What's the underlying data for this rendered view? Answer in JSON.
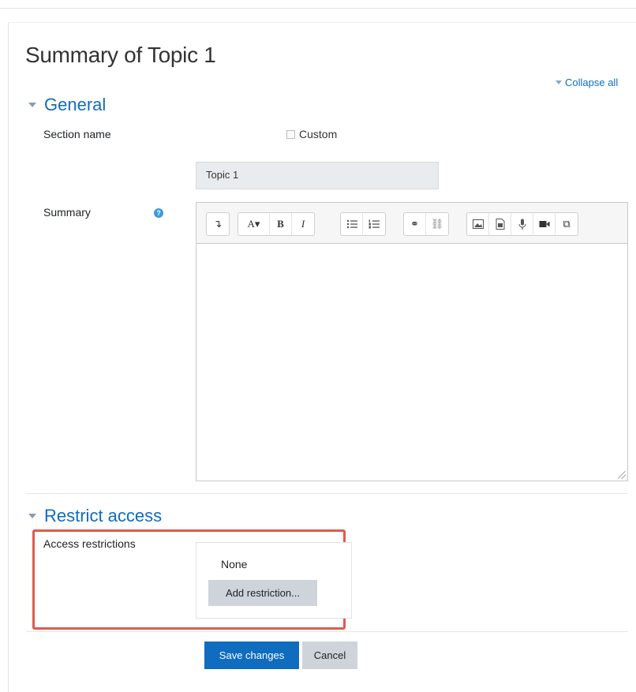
{
  "page": {
    "title": "Summary of Topic 1",
    "collapse_all": "Collapse all"
  },
  "general": {
    "legend": "General",
    "section_name_label": "Section name",
    "custom_label": "Custom",
    "section_name_value": "Topic 1",
    "summary_label": "Summary",
    "help_glyph": "?"
  },
  "editor": {
    "toolbar": {
      "paragraph": "↴",
      "font": "A▾",
      "bold": "B",
      "italic": "I",
      "link": "⚭",
      "unlink": "⛓",
      "image": "▭",
      "media": "▤",
      "record_audio": "🎙",
      "record_video": "■",
      "manage_files": "⧉"
    },
    "content": ""
  },
  "restrict": {
    "legend": "Restrict access",
    "access_label": "Access restrictions",
    "none_text": "None",
    "add_button": "Add restriction..."
  },
  "actions": {
    "save": "Save changes",
    "cancel": "Cancel"
  },
  "colors": {
    "accent": "#0f6cbf",
    "highlight": "#e05a4f",
    "button_secondary": "#ced4da"
  }
}
